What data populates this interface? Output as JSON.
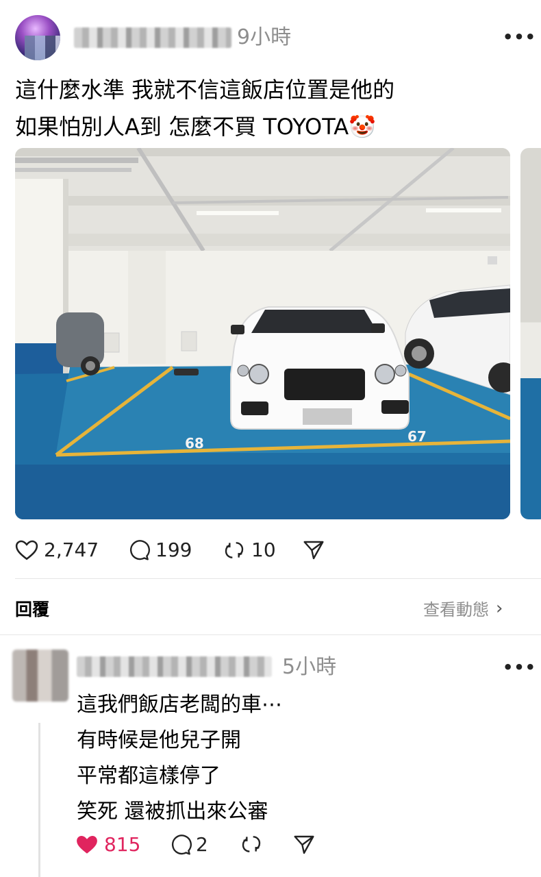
{
  "post": {
    "time": "9小時",
    "text_lines": [
      "這什麼水準 我就不信這飯店位置是他的",
      "如果怕別人A到 怎麼不買 TOYOTA🤡"
    ],
    "photo": {
      "spot_left": "68",
      "spot_right": "67"
    },
    "stats": {
      "likes": "2,747",
      "comments": "199",
      "reposts": "10"
    }
  },
  "replies_bar": {
    "reply_label": "回覆",
    "view_activity": "查看動態"
  },
  "comment": {
    "time": "5小時",
    "text_lines": [
      "這我們飯店老闆的車⋯",
      "有時候是他兒子開",
      "平常都這樣停了",
      "笑死 還被抓出來公審"
    ],
    "stats": {
      "likes": "815",
      "comments": "2"
    }
  },
  "colors": {
    "like_active": "#e0245e",
    "muted_text": "#8e8e8e",
    "floor_blue": "#1f6fa5",
    "line_yellow": "#e6b43a"
  }
}
